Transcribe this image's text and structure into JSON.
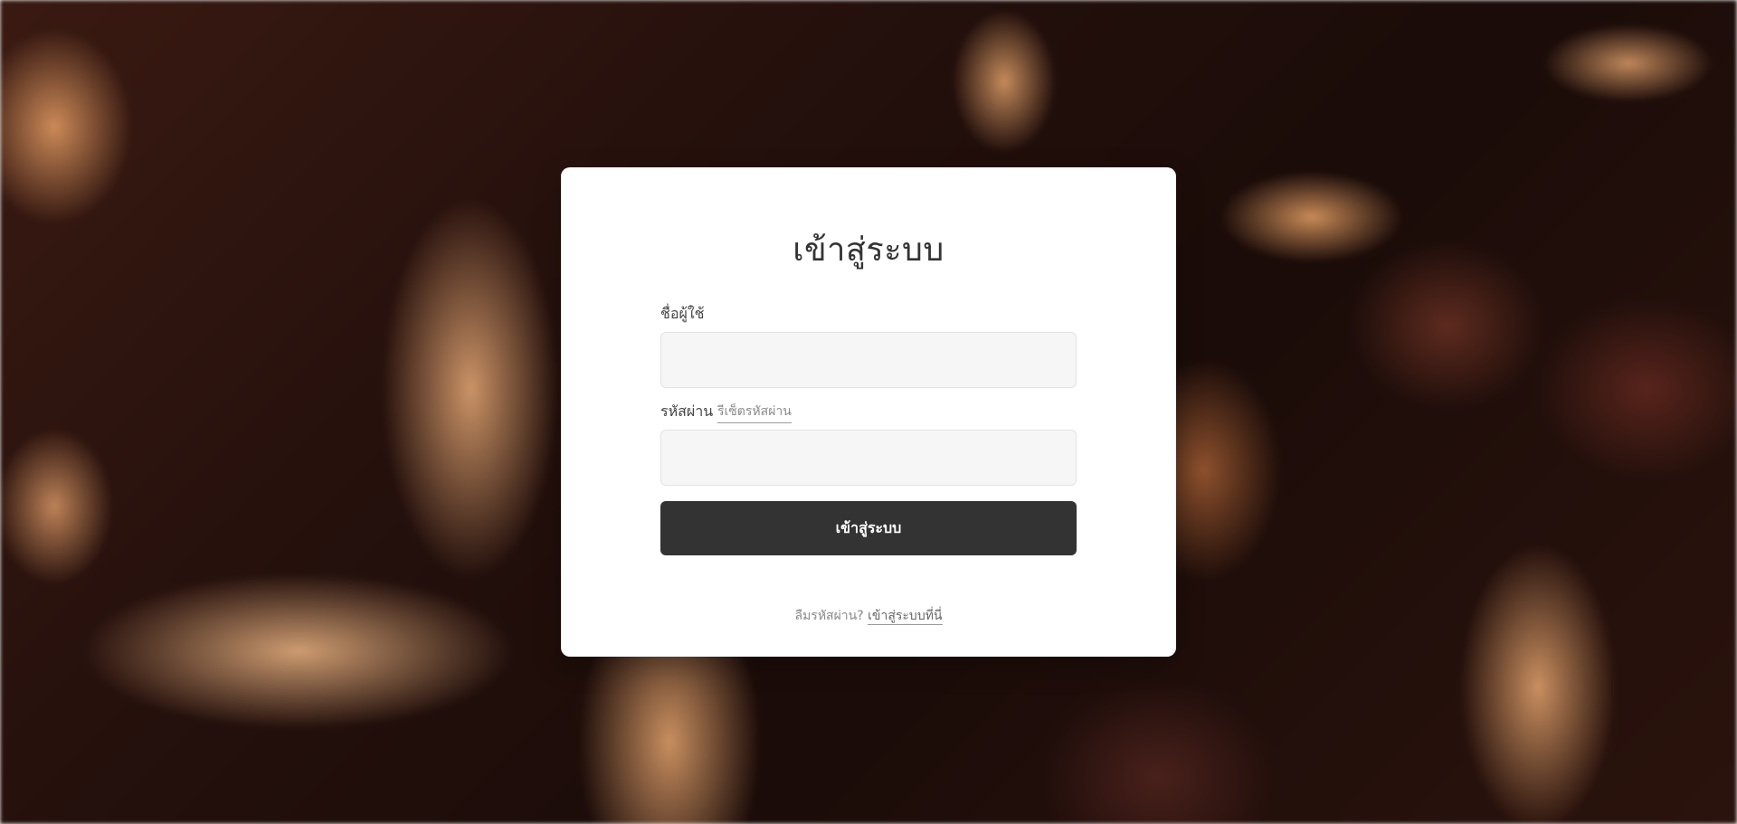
{
  "login": {
    "title": "เข้าสู่ระบบ",
    "username_label": "ชื่อผู้ใช้",
    "username_value": "",
    "password_label": "รหัสผ่าน",
    "reset_password_link": "รีเซ็ตรหัสผ่าน",
    "password_value": "",
    "submit_label": "เข้าสู่ระบบ",
    "footer_text": "ลืมรหัสผ่าน?",
    "footer_link": "เข้าสู่ระบบที่นี่"
  },
  "colors": {
    "card_background": "#ffffff",
    "button_background": "#333333",
    "button_text": "#ffffff",
    "input_background": "#f6f6f6",
    "text_primary": "#333333",
    "text_muted": "#8a8a8a"
  },
  "background": {
    "image_description_icon": "seed-pods-background"
  }
}
